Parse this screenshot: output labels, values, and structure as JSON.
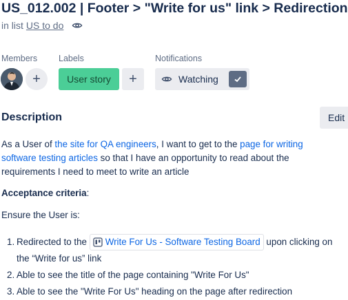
{
  "card": {
    "title": "US_012.002 | Footer > \"Write for us\" link > Redirection",
    "in_list_prefix": "in list",
    "list_name": "US to do"
  },
  "members": {
    "heading": "Members"
  },
  "labels": {
    "heading": "Labels",
    "label": "User story",
    "label_color": "#4bce97"
  },
  "notifications": {
    "heading": "Notifications",
    "button": "Watching"
  },
  "description": {
    "heading": "Description",
    "edit_button": "Edit",
    "intro_1": "As a User of ",
    "link_1": "the site for QA engineers",
    "intro_2": ", I want to get to the ",
    "link_2a": "page for writing",
    "link_2b": "software testing articles",
    "intro_3": " so that I have an opportunity to read about the",
    "intro_4": "requirements I need to meet to write an article",
    "criteria_heading": "Acceptance criteria",
    "criteria_colon": ":",
    "ensure": "Ensure the User is:",
    "items": [
      {
        "num": "1.",
        "pre": "Redirected to the ",
        "link": "Write For Us - Software Testing Board",
        "post": " upon clicking on",
        "cont": "the “Write for us” link"
      },
      {
        "num": "2.",
        "text": "Able to see the title of the page containing \"Write For Us\""
      },
      {
        "num": "3.",
        "text": "Able to see the \"Write For Us\" heading on the page after redirection"
      }
    ]
  },
  "colors": {
    "link": "#0c66e4",
    "text": "#172b4d",
    "muted": "#5e6c84",
    "button_bg": "#ebecf0"
  }
}
